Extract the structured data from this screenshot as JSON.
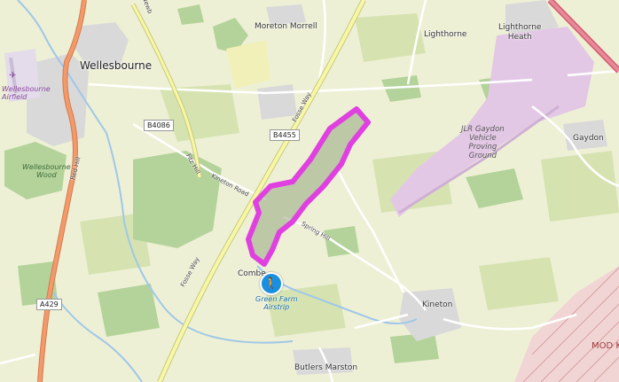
{
  "map": {
    "places": {
      "wellesbourne": "Wellesbourne",
      "moreton_morrell": "Moreton Morrell",
      "lighthorne": "Lighthorne",
      "lighthorne_heath": "Lighthorne\nHeath",
      "gaydon": "Gaydon",
      "kineton": "Kineton",
      "butlers_marston": "Butlers Marston",
      "combe": "Combe"
    },
    "features": {
      "airfield": "Wellesbourne\nAirfield",
      "wellesbourne_wood": "Wellesbourne\nWood",
      "proving_ground": "JLR Gaydon\nVehicle\nProving\nGround",
      "mod": "MOD K",
      "green_farm": "Green Farm\nAirstrip"
    },
    "roads": {
      "b4086": "B4086",
      "b4455": "B4455",
      "a429": "A429",
      "fosse_way_top": "Fosse Way",
      "fosse_way_bottom": "Fosse Way",
      "kineton_road": "Kineton Road",
      "spring_hill": "Spring Hill",
      "red_hill": "Red Hill",
      "fitz_hill": "Fitz Hill",
      "newbold": "Newb"
    },
    "colors": {
      "background": "#eef0d6",
      "woodland": "#b4d39a",
      "urban": "#d9d9d9",
      "military": "#f1d5d5",
      "proving_ground": "#e3c8e6",
      "route": "#e040e0",
      "primary_road": "#f29a6c",
      "secondary_road": "#f7f7a8",
      "water": "#9fc7e8",
      "poi": "#1a8fe0"
    },
    "icons": {
      "poi": "hiker-icon",
      "airfield": "airplane-icon"
    }
  }
}
